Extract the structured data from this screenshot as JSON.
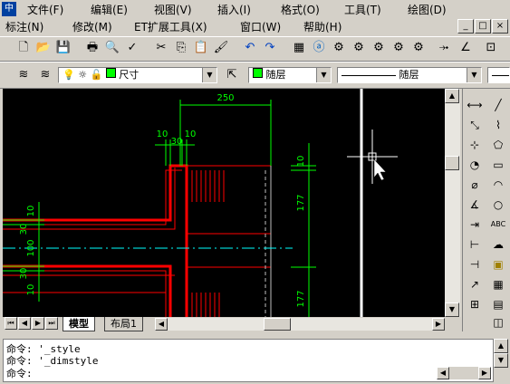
{
  "menu": {
    "row1": [
      "文件(F)",
      "编辑(E)",
      "视图(V)",
      "插入(I)",
      "格式(O)",
      "工具(T)",
      "绘图(D)"
    ],
    "row2": [
      "标注(N)",
      "修改(M)",
      "ET扩展工具(X)",
      "窗口(W)",
      "帮助(H)"
    ]
  },
  "window_controls": {
    "minimize": "_",
    "restore": "□",
    "close": "×"
  },
  "properties": {
    "dimstyle_combo": "尺寸",
    "color_combo": "随层",
    "linetype_combo": "随层"
  },
  "drawing": {
    "dim_250": "250",
    "dim_10a": "10",
    "dim_10b": "10",
    "dim_30": "30",
    "dim_10_right": "10",
    "dim_177_top": "177",
    "dim_177_bottom": "177",
    "dim_left_10a": "10",
    "dim_left_30": "30",
    "dim_left_100": "100",
    "dim_left_30b": "30",
    "dim_left_10b": "10"
  },
  "tabs": {
    "model": "模型",
    "layout1": "布局1"
  },
  "command": {
    "line1": "命令: '_style",
    "line2": "命令: '_dimstyle",
    "line3": "命令:"
  },
  "colors": {
    "canvas": "#000000",
    "wall": "#ff0000",
    "dimension": "#00ff00",
    "centerline": "#00ffff",
    "chrome": "#d4d0c8"
  }
}
